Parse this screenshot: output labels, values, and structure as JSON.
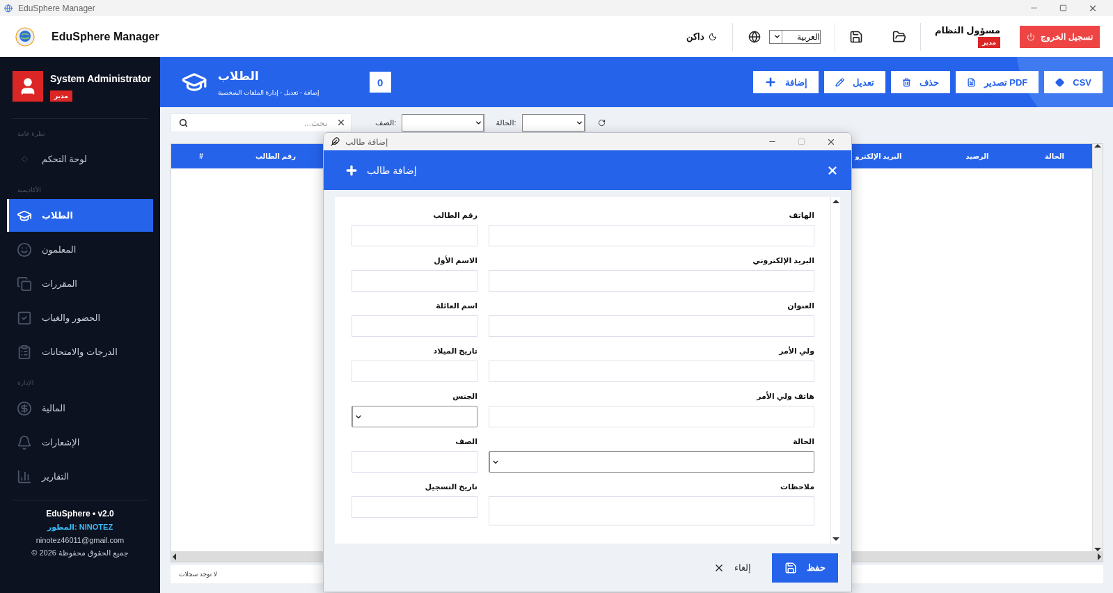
{
  "window": {
    "title": "EduSphere Manager"
  },
  "header": {
    "app_name": "EduSphere Manager",
    "theme_toggle": "داكن",
    "language": "العربية",
    "user": {
      "name": "مسؤول النظام",
      "role": "مدير"
    },
    "logout": "تسجيل الخروج"
  },
  "sidebar": {
    "user": {
      "name": "System Administrator",
      "role": "مدير"
    },
    "sections": [
      {
        "title": "نظرة عامة",
        "items": [
          {
            "label": "لوحة التحكم",
            "selected": false
          }
        ]
      },
      {
        "title": "الأكاديمية",
        "items": [
          {
            "label": "الطلاب",
            "selected": true
          },
          {
            "label": "المعلمون",
            "selected": false
          },
          {
            "label": "المقررات",
            "selected": false
          },
          {
            "label": "الحضور والغياب",
            "selected": false
          },
          {
            "label": "الدرجات والامتحانات",
            "selected": false
          }
        ]
      },
      {
        "title": "الإدارة",
        "items": [
          {
            "label": "المالية",
            "selected": false
          },
          {
            "label": "الإشعارات",
            "selected": false
          },
          {
            "label": "التقارير",
            "selected": false
          }
        ]
      }
    ],
    "footer": {
      "version": "EduSphere • v2.0",
      "developer": "المطور: NINOTEZ",
      "email": "ninotez46011@gmail.com",
      "copyright": "© 2026 جميع الحقوق محفوظة"
    }
  },
  "page": {
    "title": "الطلاب",
    "subtitle": "إضافة - تعديل - إدارة الملفات الشخصية",
    "count": "0",
    "actions": [
      {
        "label": "CSV"
      },
      {
        "label": "تصدير PDF"
      },
      {
        "label": "حذف"
      },
      {
        "label": "تعديل"
      },
      {
        "label": "إضافة"
      }
    ]
  },
  "filters": {
    "search": {
      "placeholder": "بحث..."
    },
    "selects": [
      {
        "label": "الحالة:"
      },
      {
        "label": "الصف:"
      }
    ]
  },
  "table": {
    "columns": [
      "الحالة",
      "الرصيد",
      "البريد الإلكترو",
      "رقم الطالب",
      "#"
    ],
    "empty_message": "لا توجد سجلات"
  },
  "dialog": {
    "window_title": "إضافة طالب",
    "title": "إضافة طالب",
    "fields": [
      {
        "label": "الهاتف",
        "kind": "text"
      },
      {
        "label": "رقم الطالب",
        "kind": "text"
      },
      {
        "label": "البريد الإلكتروني",
        "kind": "text"
      },
      {
        "label": "الاسم الأول",
        "kind": "text"
      },
      {
        "label": "العنوان",
        "kind": "text"
      },
      {
        "label": "اسم العائلة",
        "kind": "text"
      },
      {
        "label": "ولي الأمر",
        "kind": "text"
      },
      {
        "label": "تاريخ الميلاد",
        "kind": "text"
      },
      {
        "label": "هاتف ولي الأمر",
        "kind": "text"
      },
      {
        "label": "الجنس",
        "kind": "select"
      },
      {
        "label": "الحالة",
        "kind": "select"
      },
      {
        "label": "الصف",
        "kind": "text"
      },
      {
        "label": "ملاحظات",
        "kind": "textarea"
      },
      {
        "label": "تاريخ التسجيل",
        "kind": "text"
      }
    ],
    "save": "حفظ",
    "cancel": "إلغاء"
  }
}
